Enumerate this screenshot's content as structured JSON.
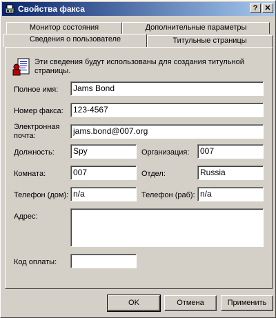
{
  "window": {
    "title": "Свойства факса",
    "help_glyph": "?",
    "close_glyph": "✕"
  },
  "tabs": {
    "row_back": [
      "Монитор состояния",
      "Дополнительные параметры"
    ],
    "row_front": [
      "Сведения о пользователе",
      "Титульные страницы"
    ],
    "active": "Сведения о пользователе"
  },
  "info_text_1": "Эти сведения будут использованы для создания титульной",
  "info_text_2": "страницы.",
  "form": {
    "full_name": {
      "label": "Полное имя:",
      "value": "Jams Bond"
    },
    "fax_number": {
      "label": "Номер факса:",
      "value": "123-4567"
    },
    "email": {
      "label_1": "Электронная",
      "label_2": "почта:",
      "value": "jams.bond@007.org"
    },
    "title": {
      "label": "Должность:",
      "value": "Spy"
    },
    "company": {
      "label": "Организация:",
      "value": "007"
    },
    "office": {
      "label": "Комната:",
      "value": "007"
    },
    "department": {
      "label": "Отдел:",
      "value": "Russia"
    },
    "home_phone": {
      "label": "Телефон (дом):",
      "value": "n/a"
    },
    "work_phone": {
      "label": "Телефон (раб):",
      "value": "n/a"
    },
    "address": {
      "label": "Адрес:",
      "value": ""
    },
    "billing_code": {
      "label": "Код оплаты:",
      "value": ""
    }
  },
  "buttons": {
    "ok": "OK",
    "cancel": "Отмена",
    "apply": "Применить"
  }
}
